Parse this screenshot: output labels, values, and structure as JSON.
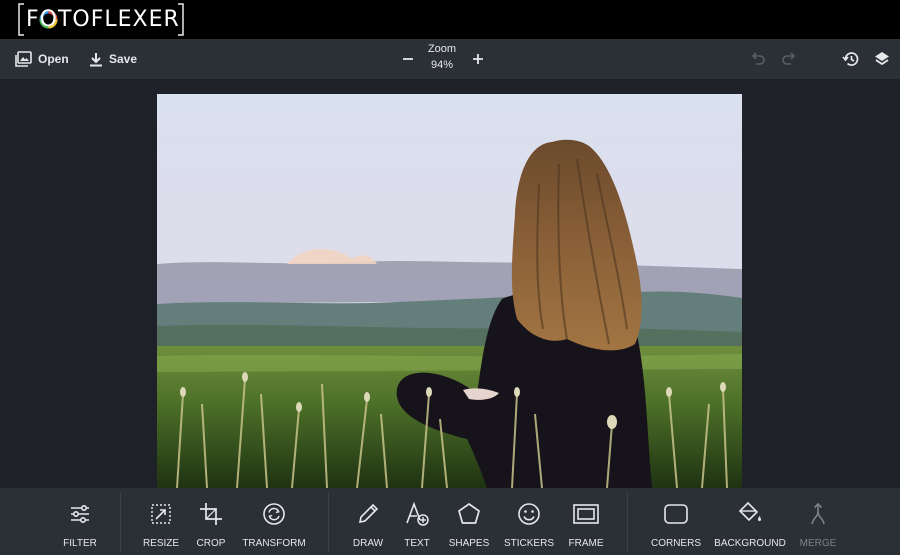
{
  "app": {
    "logo_text": "FOTOFLEXER"
  },
  "toolbar": {
    "open_label": "Open",
    "save_label": "Save",
    "zoom_label": "Zoom",
    "zoom_value": "94%"
  },
  "tools": [
    {
      "label": "FILTER",
      "icon": "sliders-icon",
      "enabled": true
    },
    {
      "label": "RESIZE",
      "icon": "resize-icon",
      "enabled": true
    },
    {
      "label": "CROP",
      "icon": "crop-icon",
      "enabled": true
    },
    {
      "label": "TRANSFORM",
      "icon": "rotate-icon",
      "enabled": true
    },
    {
      "label": "DRAW",
      "icon": "pencil-icon",
      "enabled": true
    },
    {
      "label": "TEXT",
      "icon": "text-add-icon",
      "enabled": true
    },
    {
      "label": "SHAPES",
      "icon": "pentagon-icon",
      "enabled": true
    },
    {
      "label": "STICKERS",
      "icon": "smiley-icon",
      "enabled": true
    },
    {
      "label": "FRAME",
      "icon": "frame-icon",
      "enabled": true
    },
    {
      "label": "CORNERS",
      "icon": "rounded-rect-icon",
      "enabled": true
    },
    {
      "label": "BACKGROUND",
      "icon": "paint-bucket-icon",
      "enabled": true
    },
    {
      "label": "MERGE",
      "icon": "merge-icon",
      "enabled": false
    }
  ],
  "colors": {
    "brand_bar": "#000000",
    "toolbar": "#2b2f36",
    "workspace": "#1e2127",
    "text": "#e6e8ea",
    "disabled": "#7d8289"
  }
}
